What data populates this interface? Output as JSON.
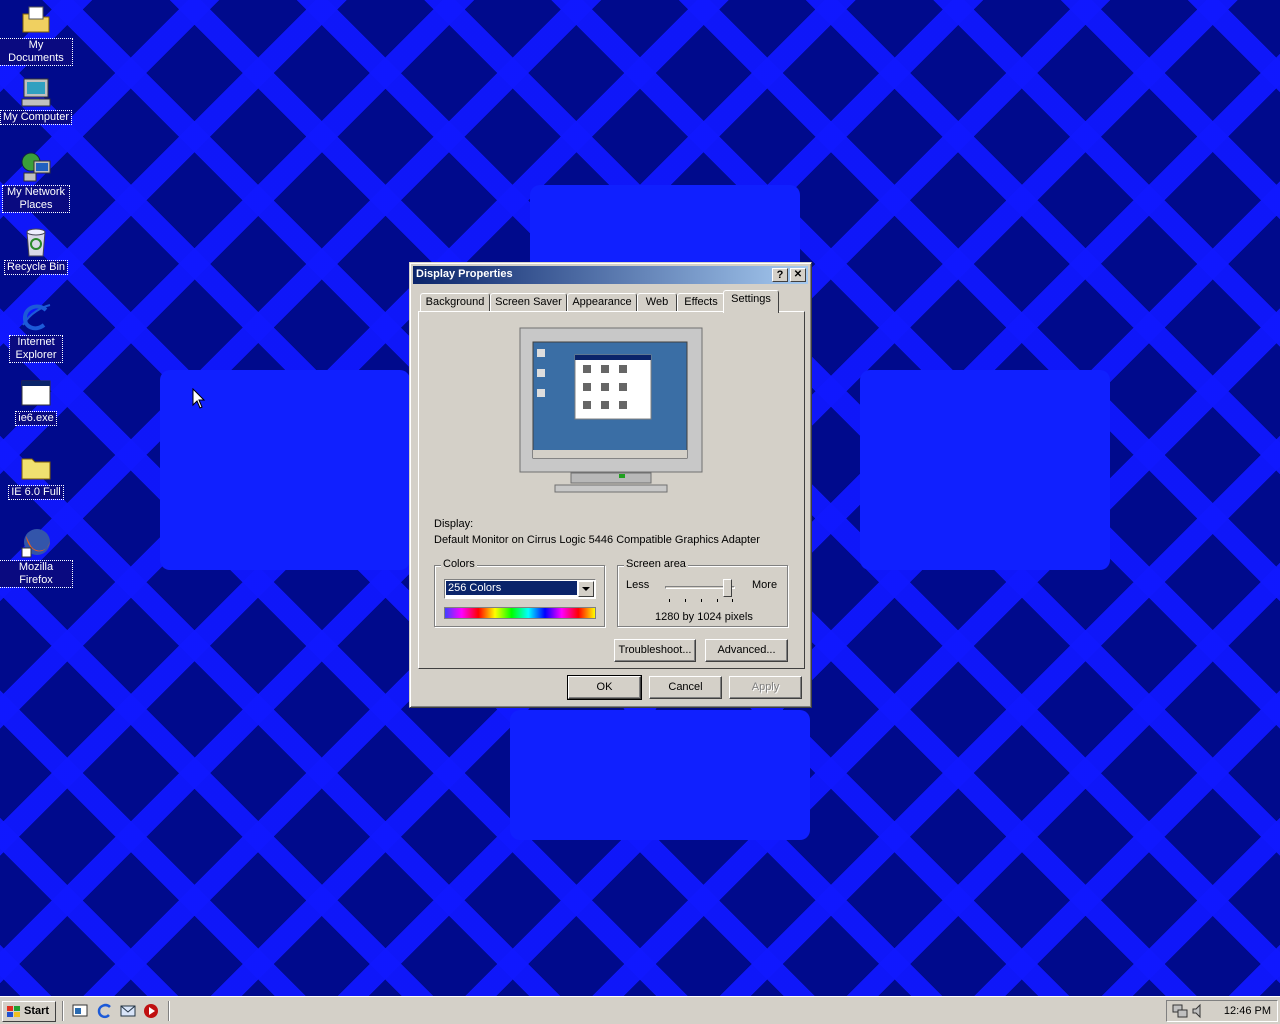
{
  "desktop": {
    "icons": [
      {
        "label": "My Documents",
        "icon": "my-documents-icon"
      },
      {
        "label": "My Computer",
        "icon": "my-computer-icon"
      },
      {
        "label": "My Network Places",
        "icon": "network-places-icon"
      },
      {
        "label": "Recycle Bin",
        "icon": "recycle-bin-icon"
      },
      {
        "label": "Internet Explorer",
        "icon": "internet-explorer-icon"
      },
      {
        "label": "ie6.exe",
        "icon": "exe-window-icon"
      },
      {
        "label": "IE 6.0 Full",
        "icon": "folder-icon"
      },
      {
        "label": "Mozilla Firefox",
        "icon": "firefox-icon"
      }
    ]
  },
  "dialog": {
    "title": "Display Properties",
    "help_button": "?",
    "close_button": "✕",
    "tabs": [
      "Background",
      "Screen Saver",
      "Appearance",
      "Web",
      "Effects",
      "Settings"
    ],
    "active_tab": "Settings",
    "display_label": "Display:",
    "display_value": "Default Monitor on Cirrus Logic 5446 Compatible Graphics Adapter",
    "colors": {
      "group_label": "Colors",
      "selected": "256 Colors"
    },
    "screen_area": {
      "group_label": "Screen area",
      "less_label": "Less",
      "more_label": "More",
      "resolution_text": "1280 by 1024 pixels",
      "slider_fraction": 1.0
    },
    "buttons": {
      "troubleshoot": "Troubleshoot...",
      "advanced": "Advanced...",
      "ok": "OK",
      "cancel": "Cancel",
      "apply": "Apply"
    }
  },
  "taskbar": {
    "start_label": "Start",
    "clock": "12:46 PM",
    "quick_launch": [
      "show-desktop-icon",
      "internet-explorer-icon",
      "outlook-icon",
      "media-player-icon"
    ]
  },
  "colors": {
    "desktop_bg": "#000a8c",
    "pattern": "#1020ff",
    "titlebar_start": "#0a246a",
    "titlebar_end": "#a6caf0",
    "face": "#d4d0c8"
  }
}
